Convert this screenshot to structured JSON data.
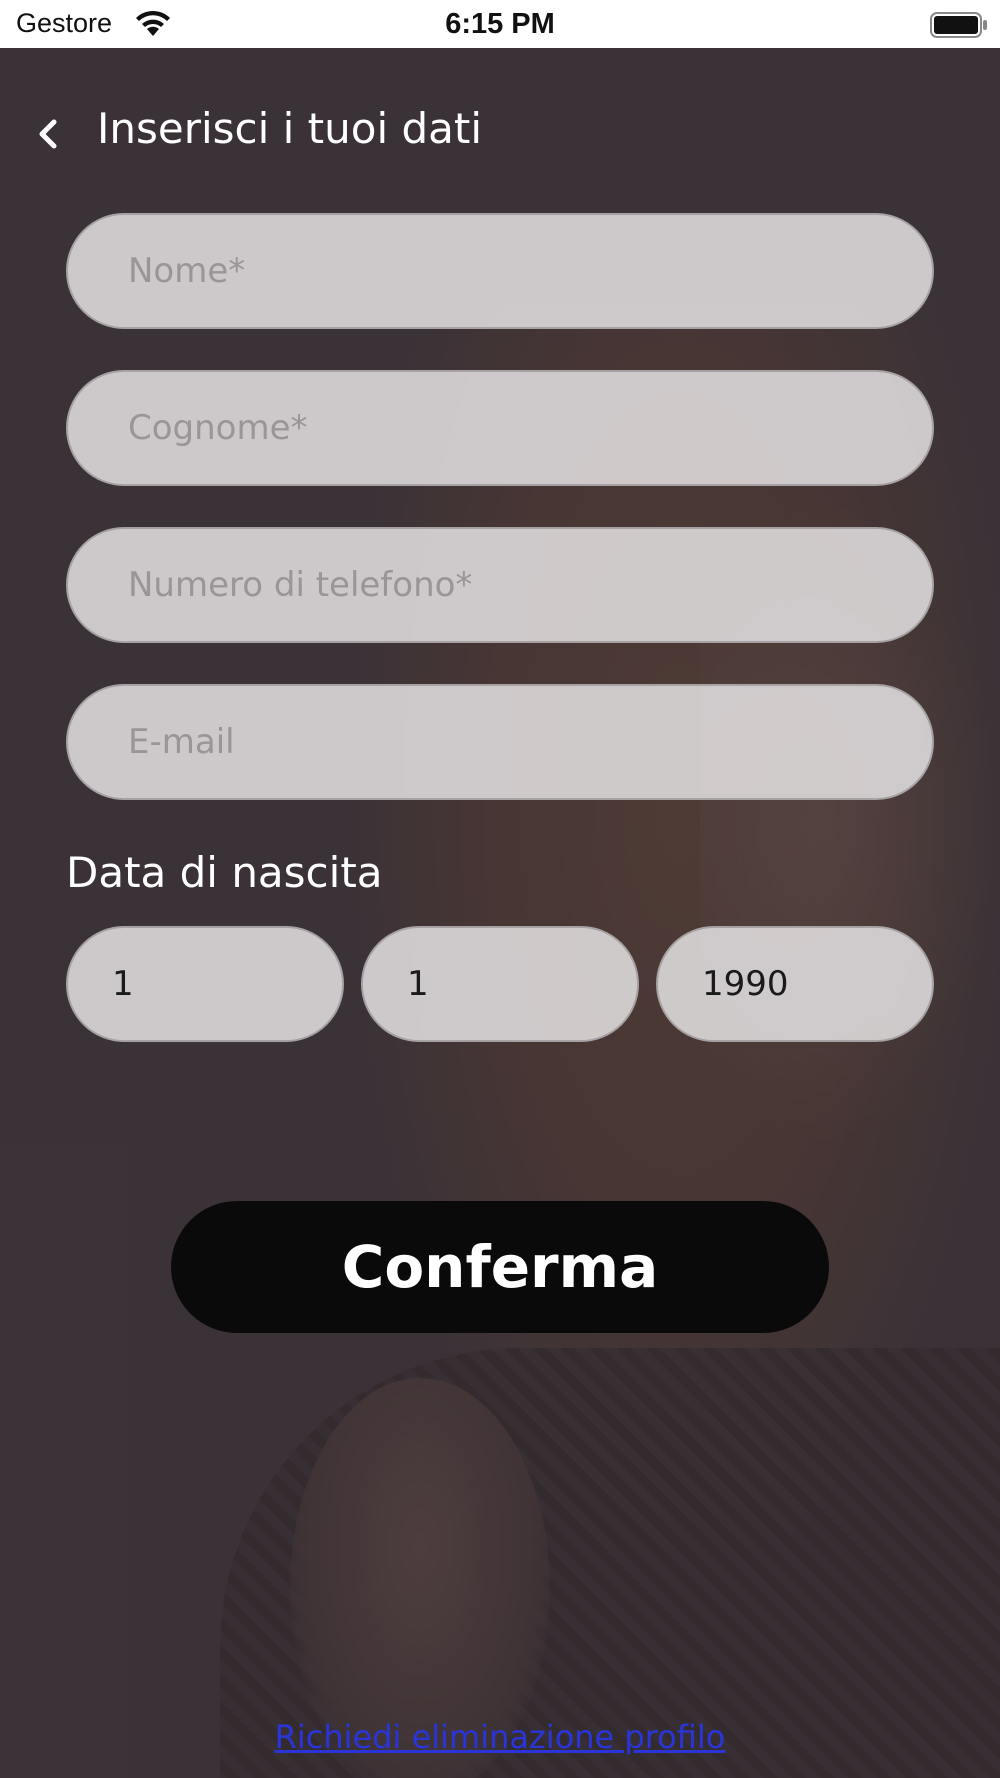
{
  "status_bar": {
    "carrier": "Gestore",
    "time": "6:15 PM"
  },
  "header": {
    "title": "Inserisci i tuoi dati"
  },
  "form": {
    "first_name_placeholder": "Nome*",
    "last_name_placeholder": "Cognome*",
    "phone_placeholder": "Numero di telefono*",
    "email_placeholder": "E-mail",
    "dob_label": "Data di nascita",
    "dob_day": "1",
    "dob_month": "1",
    "dob_year": "1990"
  },
  "actions": {
    "confirm_label": "Conferma",
    "delete_profile_label": "Richiedi eliminazione profilo"
  },
  "colors": {
    "background": "#3f373b",
    "field_fill": "#e1dedf",
    "button": "#0b0a0a",
    "link": "#2a35d9"
  }
}
